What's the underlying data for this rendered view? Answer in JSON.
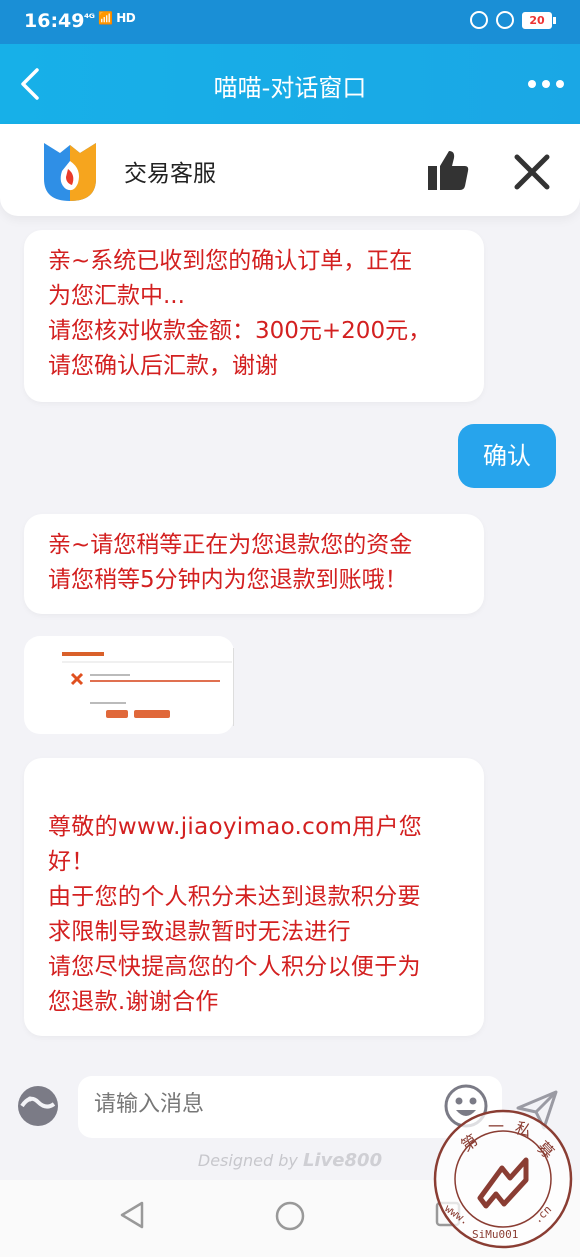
{
  "status_bar": {
    "time": "16:49",
    "network": "⁴ᴳ 📶 HD",
    "battery": "20",
    "battery_color": "#e53935"
  },
  "nav": {
    "title": "喵喵-对话窗口",
    "back_icon": "chevron-left-icon",
    "more_icon": "more-dots-icon"
  },
  "header": {
    "agent_name": "交易客服",
    "like_icon": "thumbs-up-icon",
    "close_icon": "close-icon"
  },
  "messages": {
    "msg1": "亲~系统已收到您的确认订单，正在\n为您汇款中...\n请您核对收款金额：300元+200元，\n请您确认后汇款，谢谢",
    "reply": "确认",
    "msg2": "亲~请您稍等正在为您退款您的资金\n请您稍等5分钟内为您退款到账哦！",
    "msg3": "尊敬的www.jiaoyimao.com用户您\n好！\n由于您的个人积分未达到退款积分要\n求限制导致退款暂时无法进行\n请您尽快提高您的个人积分以便于为\n您退款.谢谢合作"
  },
  "input": {
    "placeholder": "请输入消息"
  },
  "footer": {
    "designed_by": "Designed by",
    "brand": "Live800"
  },
  "watermark": {
    "text_top": "第一私募",
    "url": "www.SiMu001.cn"
  },
  "colors": {
    "accent": "#1aa7e5",
    "reply_bubble": "#27a4ec",
    "message_text": "#d32020"
  }
}
